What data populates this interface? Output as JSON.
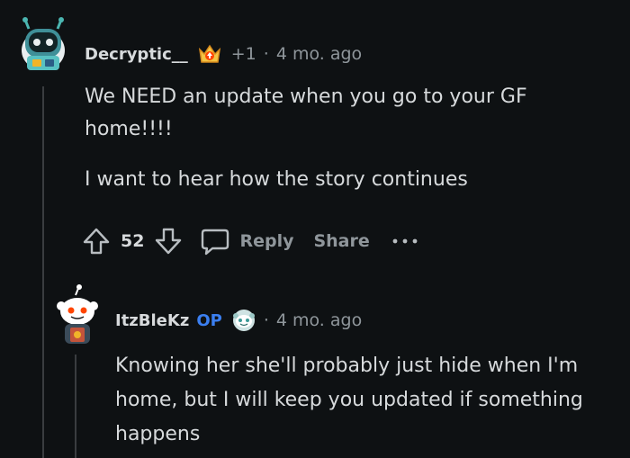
{
  "comment": {
    "author": "Decryptic__",
    "award_icon": "award-crown-icon",
    "karma_change": "+1",
    "separator": "·",
    "age": "4 mo. ago",
    "body": {
      "paragraph1": "We NEED an update when you go to your GF home!!!!",
      "paragraph2": "I want to hear how the story continues"
    },
    "actions": {
      "upvote_icon": "upvote-arrow-icon",
      "score": "52",
      "downvote_icon": "downvote-arrow-icon",
      "reply_icon": "speech-bubble-icon",
      "reply_label": "Reply",
      "share_label": "Share",
      "more_icon": "more-dots-icon"
    }
  },
  "reply": {
    "author": "ItzBleKz",
    "op_tag": "OP",
    "flair_icon": "snoo-face-icon",
    "separator": "·",
    "age": "4 mo. ago",
    "body": "Knowing her she'll probably just hide when I'm home, but I will keep you updated if something happens"
  },
  "colors": {
    "background": "#0e1113",
    "text": "#d7dadc",
    "muted": "#8f969b",
    "op_blue": "#3b7ff0",
    "thread_line": "#3a3d40"
  }
}
